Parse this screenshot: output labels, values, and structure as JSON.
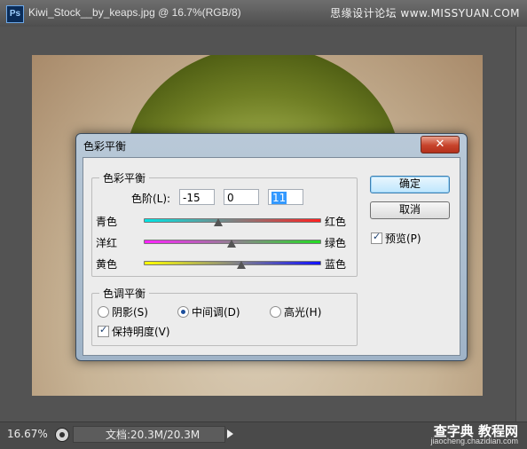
{
  "window": {
    "title": "Kiwi_Stock__by_keaps.jpg @ 16.7%(RGB/8)",
    "app_icon": "Ps"
  },
  "watermark": {
    "top": "思缘设计论坛 www.MISSYUAN.COM",
    "bottom": "查字典 教程网",
    "url": "jiaocheng.chazidian.com"
  },
  "status": {
    "zoom": "16.67%",
    "doc_info": "文档:20.3M/20.3M"
  },
  "dialog": {
    "title": "色彩平衡",
    "close_label": "✕",
    "color_balance_group": {
      "legend": "色彩平衡",
      "levels_label": "色阶(L):",
      "levels": [
        "-15",
        "0",
        "11"
      ],
      "rows": [
        {
          "left": "青色",
          "right": "红色",
          "value": -15
        },
        {
          "left": "洋红",
          "right": "绿色",
          "value": 0
        },
        {
          "left": "黄色",
          "right": "蓝色",
          "value": 11
        }
      ]
    },
    "tone_group": {
      "legend": "色调平衡",
      "shadows": "阴影(S)",
      "midtones": "中间调(D)",
      "highlights": "高光(H)",
      "selected": "midtones",
      "preserve_luminosity": "保持明度(V)",
      "preserve_checked": true
    },
    "buttons": {
      "ok": "确定",
      "cancel": "取消"
    },
    "preview": {
      "label": "预览(P)",
      "checked": true
    }
  }
}
